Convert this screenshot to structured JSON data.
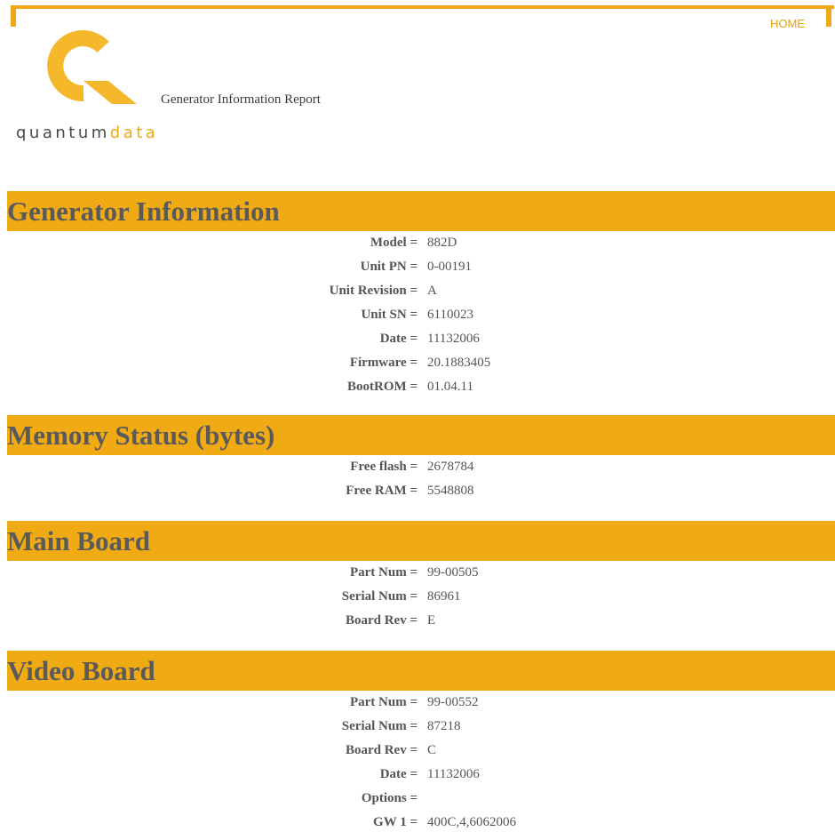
{
  "header": {
    "home_label": "HOME",
    "report_title": "Generator Information Report",
    "logo": {
      "part1": "quantum",
      "part2": "data"
    }
  },
  "colors": {
    "accent": "#f0aa14",
    "text": "#555555"
  },
  "sections": {
    "generator": {
      "title": "Generator Information",
      "rows": [
        {
          "key": "Model =",
          "value": "882D"
        },
        {
          "key": "Unit PN =",
          "value": "0-00191"
        },
        {
          "key": "Unit Revision =",
          "value": "A"
        },
        {
          "key": "Unit SN =",
          "value": "6110023"
        },
        {
          "key": "Date =",
          "value": "11132006"
        },
        {
          "key": "Firmware =",
          "value": "20.1883405"
        },
        {
          "key": "BootROM =",
          "value": "01.04.11"
        }
      ]
    },
    "memory": {
      "title": "Memory Status (bytes)",
      "rows": [
        {
          "key": "Free flash =",
          "value": "2678784"
        },
        {
          "key": "Free RAM =",
          "value": "5548808"
        }
      ]
    },
    "main_board": {
      "title": "Main Board",
      "rows": [
        {
          "key": "Part Num =",
          "value": "99-00505"
        },
        {
          "key": "Serial Num =",
          "value": "86961"
        },
        {
          "key": "Board Rev =",
          "value": "E"
        }
      ]
    },
    "video_board": {
      "title": "Video Board",
      "rows": [
        {
          "key": "Part Num =",
          "value": "99-00552"
        },
        {
          "key": "Serial Num =",
          "value": "87218"
        },
        {
          "key": "Board Rev =",
          "value": "C"
        },
        {
          "key": "Date =",
          "value": "11132006"
        },
        {
          "key": "Options =",
          "value": ""
        },
        {
          "key": "GW 1 =",
          "value": "400C,4,6062006"
        }
      ]
    }
  }
}
